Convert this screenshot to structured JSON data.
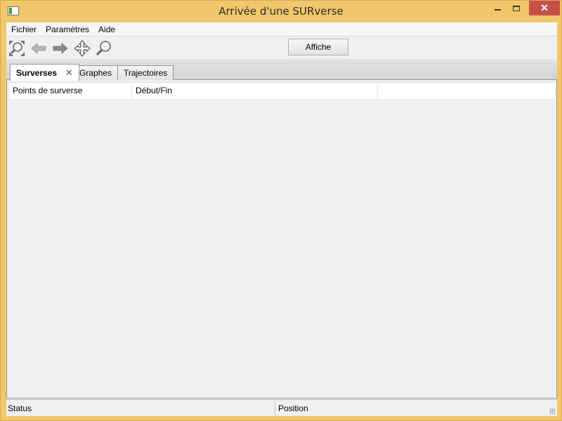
{
  "window": {
    "title": "Arrivée d'une SURverse"
  },
  "menu": {
    "items": [
      "Fichier",
      "Paramètres",
      "Aide"
    ]
  },
  "toolbar": {
    "tools": [
      {
        "name": "zoom-fit-icon"
      },
      {
        "name": "back-arrow-icon"
      },
      {
        "name": "forward-arrow-icon"
      },
      {
        "name": "pan-move-icon"
      },
      {
        "name": "zoom-region-icon"
      }
    ],
    "affiche_label": "Affiche"
  },
  "tabs": [
    {
      "label": "Surverses",
      "active": true,
      "closable": true,
      "close_glyph": "✕"
    },
    {
      "label": "Graphes",
      "active": false
    },
    {
      "label": "Trajectoires",
      "active": false
    }
  ],
  "table": {
    "columns": [
      "Points de surverse",
      "Début/Fin",
      ""
    ]
  },
  "status": {
    "left": "Status",
    "right": "Position"
  },
  "colors": {
    "frame": "#f0c76a",
    "close_button": "#c7504b",
    "client": "#f0f0f0"
  }
}
